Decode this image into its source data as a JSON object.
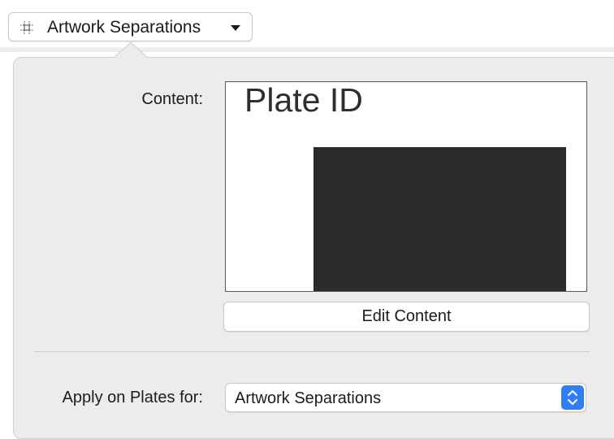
{
  "header": {
    "dropdown_label": "Artwork Separations",
    "icon": "grid-crop-icon"
  },
  "content": {
    "label": "Content:",
    "preview_text": "Plate ID",
    "edit_button_label": "Edit Content"
  },
  "apply": {
    "label": "Apply on Plates for:",
    "selected_value": "Artwork Separations"
  },
  "colors": {
    "panel_background": "#ececec",
    "accent": "#2f7ef6",
    "preview_block": "#2b2b2b"
  }
}
